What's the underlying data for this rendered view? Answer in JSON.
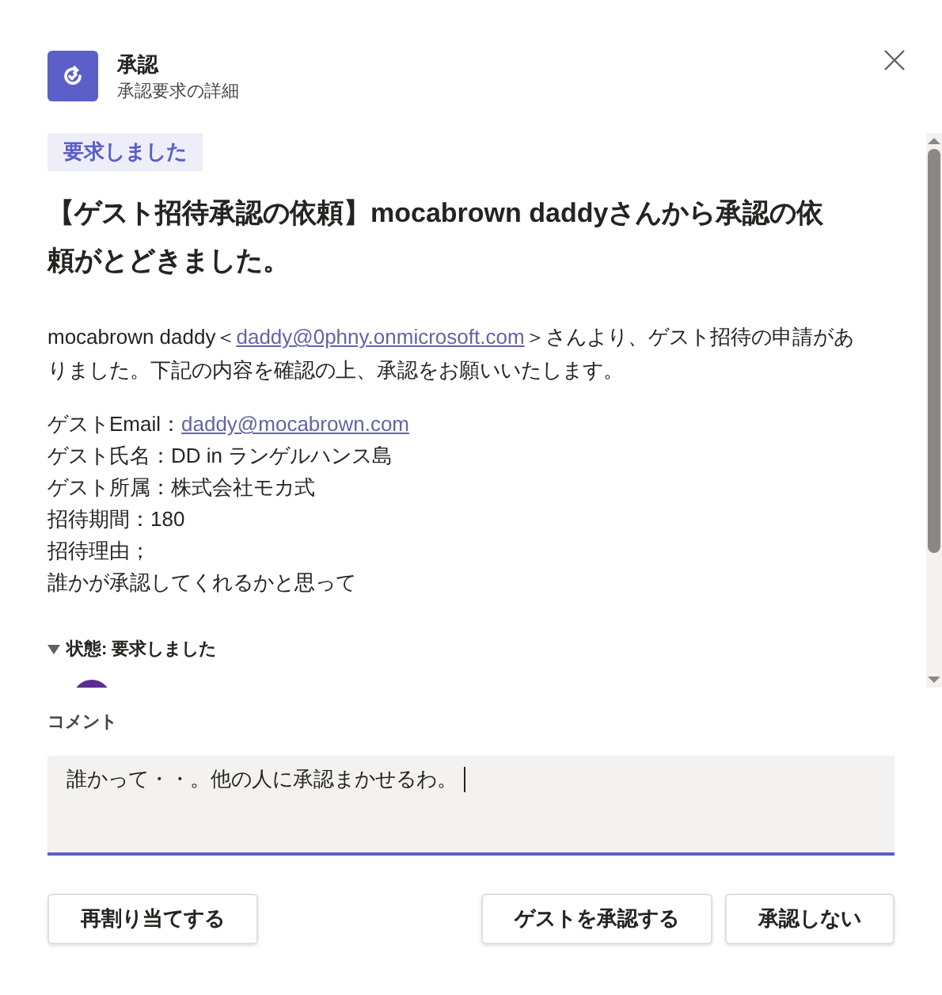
{
  "header": {
    "title": "承認",
    "subtitle": "承認要求の詳細"
  },
  "status_badge": "要求しました",
  "heading": "【ゲスト招待承認の依頼】mocabrown daddyさんから承認の依頼がとどきました。",
  "intro": {
    "before": "mocabrown daddy＜",
    "link": "daddy@0phny.onmicrosoft.com",
    "after": "＞さんより、ゲスト招待の申請がありました。下記の内容を確認の上、承認をお願いいたします。"
  },
  "details": [
    {
      "text": "ゲストEmail：",
      "link": "daddy@mocabrown.com"
    },
    {
      "text": "ゲスト氏名：DD in ランゲルハンス島"
    },
    {
      "text": "ゲスト所属：株式会社モカ式"
    },
    {
      "text": "招待期間：180"
    },
    {
      "text": "招待理由；"
    },
    {
      "text": "誰かが承認してくれるかと思って"
    }
  ],
  "status_section": {
    "label": "状態: 要求しました",
    "expanded": true
  },
  "comment": {
    "label": "コメント",
    "value": "誰かって・・。他の人に承認まかせるわ。"
  },
  "left_buttons": [
    "再割り当てする"
  ],
  "right_buttons": [
    "ゲストを承認する",
    "承認しない"
  ]
}
